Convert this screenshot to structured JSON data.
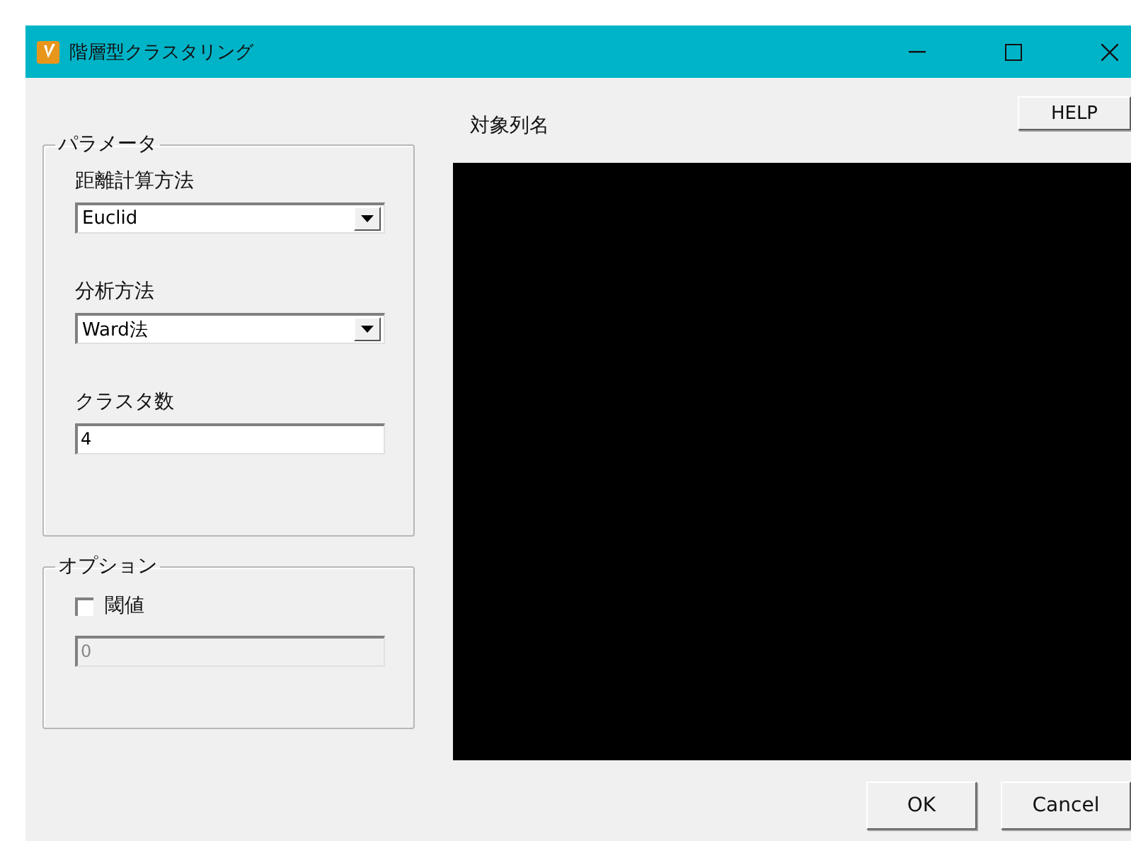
{
  "window": {
    "title": "階層型クラスタリング"
  },
  "parameters": {
    "legend": "パラメータ",
    "fields": [
      {
        "kind": "select",
        "label": "距離計算方法",
        "value": "Euclid"
      },
      {
        "kind": "select",
        "label": "分析方法",
        "value": "Ward法"
      },
      {
        "kind": "input",
        "label": "クラスタ数",
        "value": "4"
      }
    ]
  },
  "options": {
    "legend": "オプション",
    "checkbox": {
      "label": "閾値",
      "checked": false
    },
    "threshold": {
      "value": "0",
      "disabled": true
    }
  },
  "target_columns": {
    "label": "対象列名"
  },
  "help_button": "HELP",
  "buttons": [
    "OK",
    "Cancel"
  ]
}
